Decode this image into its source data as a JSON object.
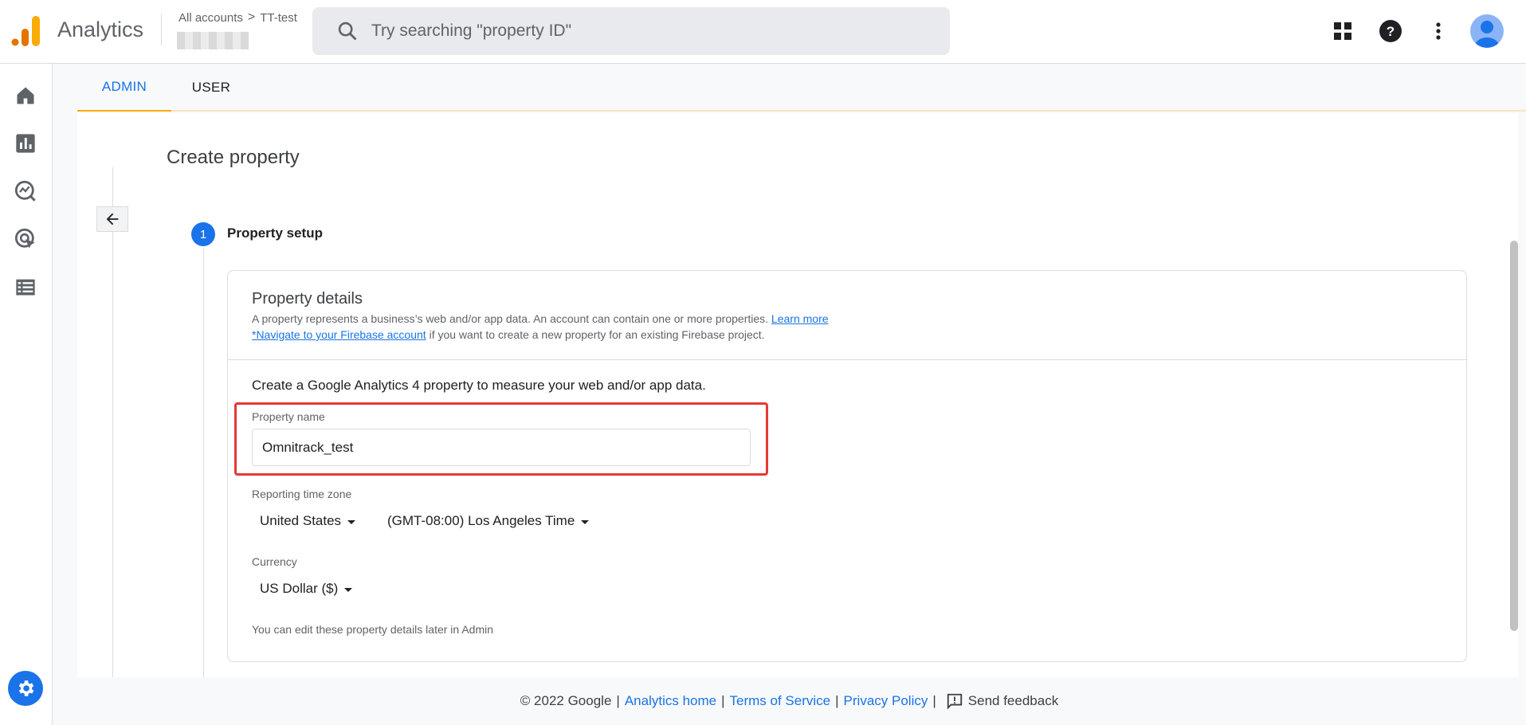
{
  "header": {
    "app_name": "Analytics",
    "breadcrumb_all": "All accounts",
    "breadcrumb_sep": ">",
    "breadcrumb_account": "TT-test",
    "search_placeholder": "Try searching \"property ID\""
  },
  "tabs": [
    {
      "label": "ADMIN",
      "active": true
    },
    {
      "label": "USER",
      "active": false
    }
  ],
  "page": {
    "title": "Create property",
    "step_number": "1",
    "step_label": "Property setup"
  },
  "card": {
    "title": "Property details",
    "desc1_text": "A property represents a business’s web and/or app data. An account can contain one or more properties.",
    "desc1_link": "Learn more",
    "desc2_link": "*Navigate to your Firebase account",
    "desc2_text": "if you want to create a new property for an existing Firebase project.",
    "intro": "Create a Google Analytics 4 property to measure your web and/or app data.",
    "property_name_label": "Property name",
    "property_name_value": "Omnitrack_test",
    "timezone_label": "Reporting time zone",
    "country_value": "United States",
    "timezone_value": "(GMT-08:00) Los Angeles Time",
    "currency_label": "Currency",
    "currency_value": "US Dollar ($)",
    "note": "You can edit these property details later in Admin"
  },
  "footer": {
    "copyright": "© 2022 Google",
    "analytics_home": "Analytics home",
    "terms": "Terms of Service",
    "privacy": "Privacy Policy",
    "feedback": "Send feedback",
    "separator": "|"
  },
  "colors": {
    "accent": "#1a73e8",
    "tab_underline": "#f9ab00",
    "highlight": "#e53935"
  }
}
